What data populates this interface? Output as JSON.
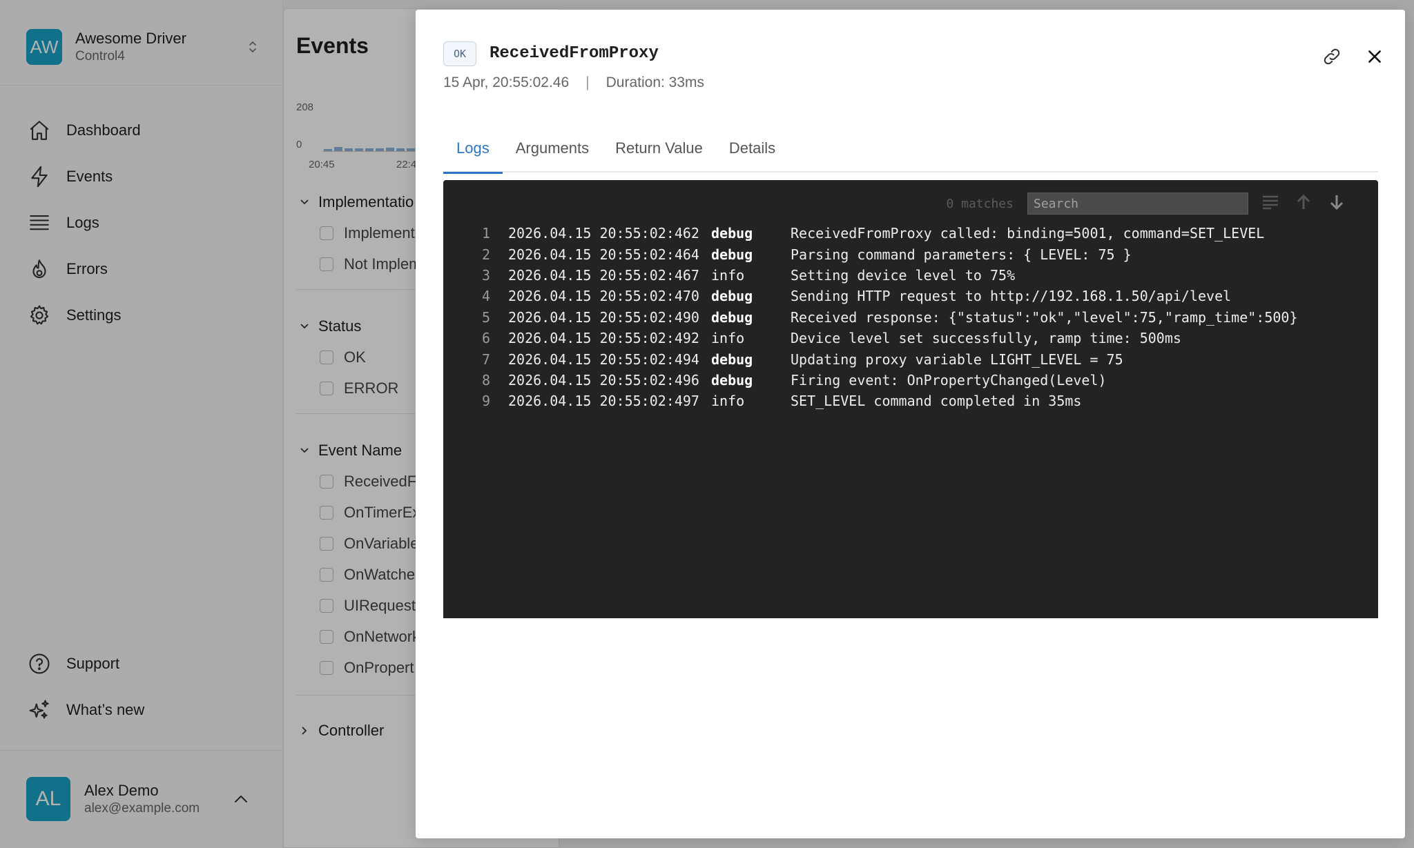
{
  "sidebar": {
    "org": {
      "initials": "AW",
      "name": "Awesome Driver",
      "sub": "Control4"
    },
    "nav": [
      {
        "label": "Dashboard",
        "icon": "home-icon"
      },
      {
        "label": "Events",
        "icon": "lightning-icon"
      },
      {
        "label": "Logs",
        "icon": "list-icon"
      },
      {
        "label": "Errors",
        "icon": "fire-icon"
      },
      {
        "label": "Settings",
        "icon": "gear-icon"
      }
    ],
    "bottom_nav": [
      {
        "label": "Support",
        "icon": "question-icon"
      },
      {
        "label": "What’s new",
        "icon": "sparkles-icon"
      }
    ],
    "user": {
      "initials": "AL",
      "name": "Alex Demo",
      "email": "alex@example.com"
    }
  },
  "events_panel": {
    "title": "Events",
    "chart": {
      "y_max_label": "208",
      "y_min_label": "0",
      "x_labels": [
        "20:45",
        "22:4"
      ]
    },
    "filters": {
      "implementation": {
        "label": "Implementatio",
        "options": [
          "Implement",
          "Not Implem"
        ]
      },
      "status": {
        "label": "Status",
        "options": [
          "OK",
          "ERROR"
        ]
      },
      "event_name": {
        "label": "Event Name",
        "options": [
          "ReceivedF",
          "OnTimerEx",
          "OnVariable",
          "OnWatche",
          "UIRequest",
          "OnNetwork",
          "OnPropert"
        ]
      },
      "controller": {
        "label": "Controller"
      }
    }
  },
  "modal": {
    "status_badge": "OK",
    "title": "ReceivedFromProxy",
    "timestamp": "15 Apr, 20:55:02.46",
    "separator": "|",
    "duration": "Duration: 33ms",
    "tabs": [
      "Logs",
      "Arguments",
      "Return Value",
      "Details"
    ],
    "active_tab": "Logs",
    "console": {
      "matches": "0 matches",
      "search_placeholder": "Search",
      "lines": [
        {
          "n": "1",
          "ts": "2026.04.15 20:55:02:462",
          "level": "debug",
          "msg": "ReceivedFromProxy called: binding=5001, command=SET_LEVEL"
        },
        {
          "n": "2",
          "ts": "2026.04.15 20:55:02:464",
          "level": "debug",
          "msg": "Parsing command parameters: { LEVEL: 75 }"
        },
        {
          "n": "3",
          "ts": "2026.04.15 20:55:02:467",
          "level": "info",
          "msg": "Setting device level to 75%"
        },
        {
          "n": "4",
          "ts": "2026.04.15 20:55:02:470",
          "level": "debug",
          "msg": "Sending HTTP request to http://192.168.1.50/api/level"
        },
        {
          "n": "5",
          "ts": "2026.04.15 20:55:02:490",
          "level": "debug",
          "msg": "Received response: {\"status\":\"ok\",\"level\":75,\"ramp_time\":500}"
        },
        {
          "n": "6",
          "ts": "2026.04.15 20:55:02:492",
          "level": "info",
          "msg": "Device level set successfully, ramp time: 500ms"
        },
        {
          "n": "7",
          "ts": "2026.04.15 20:55:02:494",
          "level": "debug",
          "msg": "Updating proxy variable LIGHT_LEVEL = 75"
        },
        {
          "n": "8",
          "ts": "2026.04.15 20:55:02:496",
          "level": "debug",
          "msg": "Firing event: OnPropertyChanged(Level)"
        },
        {
          "n": "9",
          "ts": "2026.04.15 20:55:02:497",
          "level": "info",
          "msg": "SET_LEVEL command completed in 35ms"
        }
      ]
    }
  },
  "colors": {
    "accent": "#2a77c9",
    "avatar": "#1ba3c6",
    "console_bg": "#232323"
  }
}
